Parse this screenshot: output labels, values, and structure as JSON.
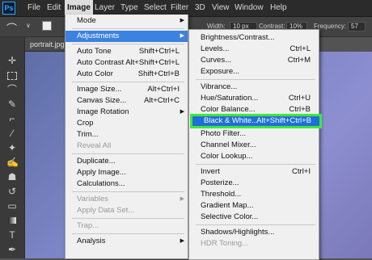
{
  "menubar": {
    "logo": "Ps",
    "items": [
      "File",
      "Edit",
      "Image",
      "Layer",
      "Type",
      "Select",
      "Filter",
      "3D",
      "View",
      "Window",
      "Help"
    ]
  },
  "options": {
    "width_label": "Width:",
    "width_value": "10 px",
    "contrast_label": "Contrast:",
    "contrast_value": "10%",
    "frequency_label": "Frequency:",
    "frequency_value": "57"
  },
  "document": {
    "tab": "portrait.jpg"
  },
  "image_menu": [
    {
      "label": "Mode",
      "shortcut": "",
      "arrow": true,
      "disabled": false
    },
    {
      "sep": true
    },
    {
      "label": "Adjustments",
      "shortcut": "",
      "arrow": true,
      "disabled": false,
      "highlight": true
    },
    {
      "sep": true
    },
    {
      "label": "Auto Tone",
      "shortcut": "Shift+Ctrl+L",
      "disabled": false
    },
    {
      "label": "Auto Contrast",
      "shortcut": "Alt+Shift+Ctrl+L",
      "disabled": false
    },
    {
      "label": "Auto Color",
      "shortcut": "Shift+Ctrl+B",
      "disabled": false
    },
    {
      "sep": true
    },
    {
      "label": "Image Size...",
      "shortcut": "Alt+Ctrl+I",
      "disabled": false
    },
    {
      "label": "Canvas Size...",
      "shortcut": "Alt+Ctrl+C",
      "disabled": false
    },
    {
      "label": "Image Rotation",
      "shortcut": "",
      "arrow": true,
      "disabled": false
    },
    {
      "label": "Crop",
      "shortcut": "",
      "disabled": false
    },
    {
      "label": "Trim...",
      "shortcut": "",
      "disabled": false
    },
    {
      "label": "Reveal All",
      "shortcut": "",
      "disabled": true
    },
    {
      "sep": true
    },
    {
      "label": "Duplicate...",
      "shortcut": "",
      "disabled": false
    },
    {
      "label": "Apply Image...",
      "shortcut": "",
      "disabled": false
    },
    {
      "label": "Calculations...",
      "shortcut": "",
      "disabled": false
    },
    {
      "sep": true
    },
    {
      "label": "Variables",
      "shortcut": "",
      "arrow": true,
      "disabled": true
    },
    {
      "label": "Apply Data Set...",
      "shortcut": "",
      "disabled": true
    },
    {
      "sep": true
    },
    {
      "label": "Trap...",
      "shortcut": "",
      "disabled": true
    },
    {
      "sep": true
    },
    {
      "label": "Analysis",
      "shortcut": "",
      "arrow": true,
      "disabled": false
    }
  ],
  "adjustments_menu": [
    {
      "label": "Brightness/Contrast...",
      "shortcut": "",
      "disabled": false
    },
    {
      "label": "Levels...",
      "shortcut": "Ctrl+L",
      "disabled": false
    },
    {
      "label": "Curves...",
      "shortcut": "Ctrl+M",
      "disabled": false
    },
    {
      "label": "Exposure...",
      "shortcut": "",
      "disabled": false
    },
    {
      "sep": true
    },
    {
      "label": "Vibrance...",
      "shortcut": "",
      "disabled": false
    },
    {
      "label": "Hue/Saturation...",
      "shortcut": "Ctrl+U",
      "disabled": false
    },
    {
      "label": "Color Balance...",
      "shortcut": "Ctrl+B",
      "disabled": false
    },
    {
      "label": "Black & White...",
      "shortcut": "Alt+Shift+Ctrl+B",
      "disabled": false,
      "selected": true
    },
    {
      "label": "Photo Filter...",
      "shortcut": "",
      "disabled": false
    },
    {
      "label": "Channel Mixer...",
      "shortcut": "",
      "disabled": false
    },
    {
      "label": "Color Lookup...",
      "shortcut": "",
      "disabled": false
    },
    {
      "sep": true
    },
    {
      "label": "Invert",
      "shortcut": "Ctrl+I",
      "disabled": false
    },
    {
      "label": "Posterize...",
      "shortcut": "",
      "disabled": false
    },
    {
      "label": "Threshold...",
      "shortcut": "",
      "disabled": false
    },
    {
      "label": "Gradient Map...",
      "shortcut": "",
      "disabled": false
    },
    {
      "label": "Selective Color...",
      "shortcut": "",
      "disabled": false
    },
    {
      "sep": true
    },
    {
      "label": "Shadows/Highlights...",
      "shortcut": "",
      "disabled": false
    },
    {
      "label": "HDR Toning...",
      "shortcut": "",
      "disabled": true
    }
  ],
  "tools": [
    "move-icon",
    "marquee-icon",
    "lasso-icon",
    "quick-select-icon",
    "crop-icon",
    "eyedropper-icon",
    "healing-icon",
    "brush-icon",
    "clone-stamp-icon",
    "history-brush-icon",
    "eraser-icon",
    "gradient-icon",
    "blur-icon",
    "dodge-icon",
    "pen-icon",
    "type-icon",
    "path-select-icon",
    "shape-icon",
    "hand-icon"
  ],
  "colors": {
    "highlight": "#3c82e0",
    "selected_border": "#3ee83a",
    "accent": "#31a8ff"
  }
}
